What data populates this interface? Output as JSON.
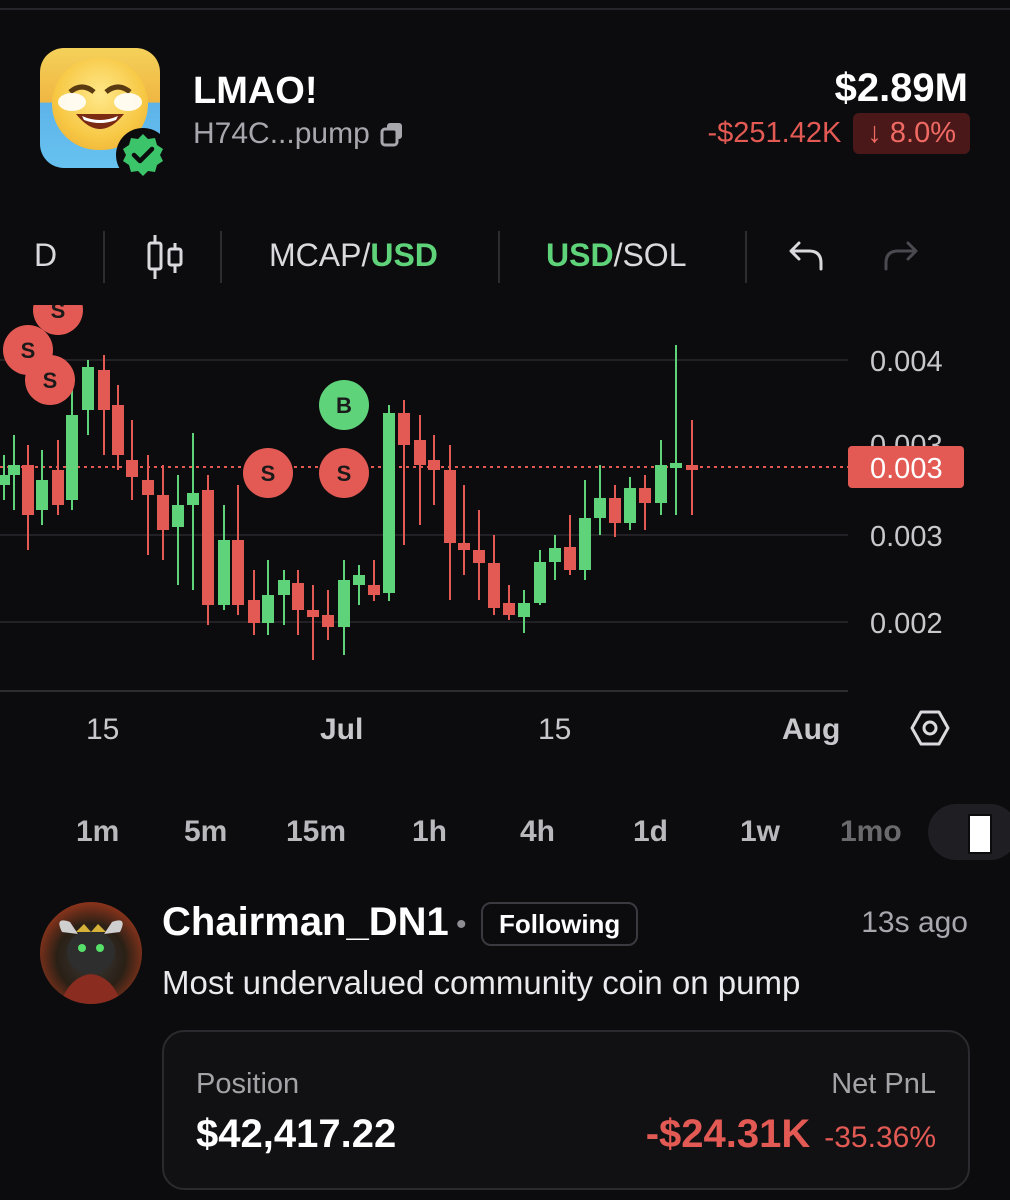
{
  "token": {
    "name": "LMAO!",
    "address": "H74C...pump",
    "market_cap": "$2.89M",
    "change_abs": "-$251.42K",
    "change_pct": "↓ 8.0%"
  },
  "toolbar": {
    "interval_letter": "D",
    "mcap_label": "MCAP/",
    "mcap_unit": "USD",
    "quote_green": "USD",
    "quote_rest": "/SOL"
  },
  "chart_data": {
    "type": "candlestick",
    "x_labels": [
      "15",
      "Jul",
      "15",
      "Aug"
    ],
    "y_ticks": [
      "0.004",
      "0.003",
      "0.002"
    ],
    "overlapped_tick": "0.003",
    "current_price_label": "0.003",
    "colors": {
      "up": "#5fd37a",
      "down": "#e35a54"
    },
    "trade_markers": [
      {
        "label": "S",
        "side": "sell"
      },
      {
        "label": "S",
        "side": "sell"
      },
      {
        "label": "S",
        "side": "sell"
      },
      {
        "label": "B",
        "side": "buy"
      },
      {
        "label": "S",
        "side": "sell"
      },
      {
        "label": "S",
        "side": "sell"
      }
    ]
  },
  "timeframes": [
    "1m",
    "5m",
    "15m",
    "1h",
    "4h",
    "1d",
    "1w",
    "1mo"
  ],
  "post": {
    "username": "Chairman_DN1",
    "separator": "•",
    "follow_label": "Following",
    "time_ago": "13s ago",
    "text": "Most undervalued community coin on pump",
    "position_label": "Position",
    "position_value": "$42,417.22",
    "pnl_label": "Net PnL",
    "pnl_value": "-$24.31K",
    "pnl_pct": "-35.36%"
  },
  "icons": [
    "verified-check-icon",
    "copy-icon",
    "candlestick-icon",
    "undo-icon",
    "redo-icon",
    "settings-hex-icon"
  ]
}
